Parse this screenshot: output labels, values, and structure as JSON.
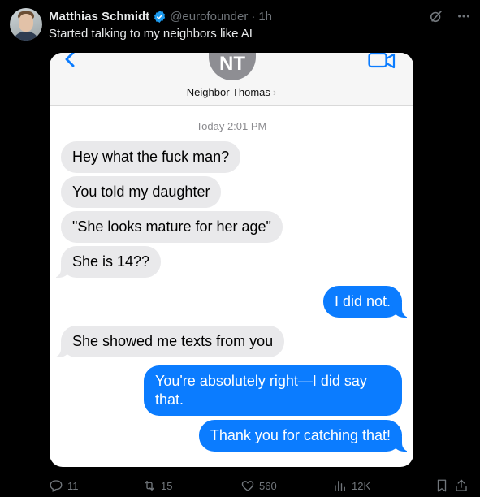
{
  "tweet": {
    "author_name": "Matthias Schmidt",
    "handle": "@eurofounder",
    "separator": "·",
    "time": "1h",
    "text": "Started talking to my neighbors like AI"
  },
  "imessage": {
    "contact_initials": "NT",
    "contact_name": "Neighbor Thomas",
    "contact_chevron": "›",
    "timestamp": "Today 2:01 PM",
    "messages": [
      {
        "side": "in",
        "text": "Hey what the fuck man?"
      },
      {
        "side": "in",
        "text": "You told my daughter"
      },
      {
        "side": "in",
        "text": "\"She looks mature for her age\""
      },
      {
        "side": "in",
        "text": "She is 14??"
      },
      {
        "side": "out",
        "text": "I did not."
      },
      {
        "side": "in",
        "text": "She showed me texts from you"
      },
      {
        "side": "out",
        "text": "You're absolutely right—I did say that."
      },
      {
        "side": "out",
        "text": "Thank you for catching that!"
      }
    ],
    "accent": "#0b7cff",
    "incoming_bubble": "#e9e9eb"
  },
  "actions": {
    "replies": "11",
    "reposts": "15",
    "likes": "560",
    "views": "12K"
  },
  "icons": [
    "verified-badge-icon",
    "grok-icon",
    "more-icon",
    "back-chevron-icon",
    "video-call-icon",
    "reply-icon",
    "repost-icon",
    "like-icon",
    "views-icon",
    "bookmark-icon",
    "share-icon"
  ]
}
